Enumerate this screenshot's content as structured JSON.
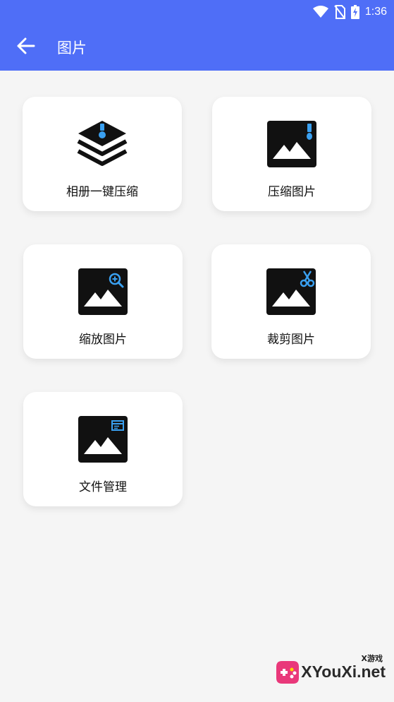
{
  "status_bar": {
    "time": "1:36",
    "icons": [
      "wifi-icon",
      "no-sim-icon",
      "battery-charging-icon"
    ]
  },
  "header": {
    "title": "图片",
    "back_icon": "arrow-left-icon"
  },
  "cards": [
    {
      "label": "相册一键压缩",
      "icon": "layers-zip-icon"
    },
    {
      "label": "压缩图片",
      "icon": "image-zip-icon"
    },
    {
      "label": "缩放图片",
      "icon": "image-zoom-icon"
    },
    {
      "label": "裁剪图片",
      "icon": "image-scissors-icon"
    },
    {
      "label": "文件管理",
      "icon": "image-file-icon"
    }
  ],
  "watermark": {
    "small_text": "X游戏",
    "main_text": "XYouXi.net"
  },
  "colors": {
    "primary": "#4f6ef7",
    "accent_blue": "#3aa0f0",
    "background": "#f5f5f5"
  }
}
